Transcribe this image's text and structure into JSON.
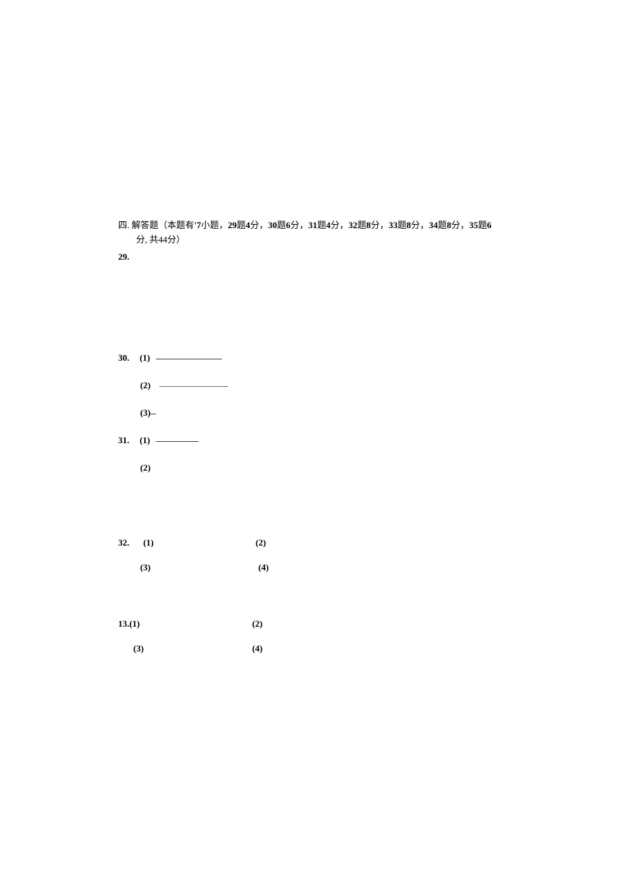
{
  "section": {
    "prefix": "四. 解答题（本题有",
    "count": "'7",
    "count_suffix": "小题，",
    "parts": [
      {
        "q": "29",
        "mid": "题",
        "pts": "4",
        "suffix": "分，"
      },
      {
        "q": "30",
        "mid": "题",
        "pts": "6",
        "suffix": "分，"
      },
      {
        "q": "31",
        "mid": "题",
        "pts": "4",
        "suffix": "分，"
      },
      {
        "q": "32",
        "mid": "题",
        "pts": "8",
        "suffix": "分，"
      },
      {
        "q": "33",
        "mid": "题",
        "pts": "8",
        "suffix": "分，"
      },
      {
        "q": "34",
        "mid": "题",
        "pts": "8",
        "suffix": "分，"
      },
      {
        "q": "35",
        "mid": "题",
        "pts": "6",
        "suffix": ""
      }
    ],
    "line2_tail": "分, 共",
    "total": "44",
    "line2_end": "分）"
  },
  "q29": {
    "num": "29."
  },
  "q30": {
    "num": "30.",
    "s1": "(1)",
    "s2": "(2)",
    "s3": "(3)"
  },
  "q31": {
    "num": "31.",
    "s1": "(1)",
    "s2": "(2)"
  },
  "q32": {
    "num": "32.",
    "s1": "(1)",
    "s2": "(2)",
    "s3": "(3)",
    "s4": "(4)"
  },
  "q13": {
    "num": "13.",
    "s1": "(1)",
    "s2": "(2)",
    "s3": "(3)",
    "s4": "(4)"
  }
}
